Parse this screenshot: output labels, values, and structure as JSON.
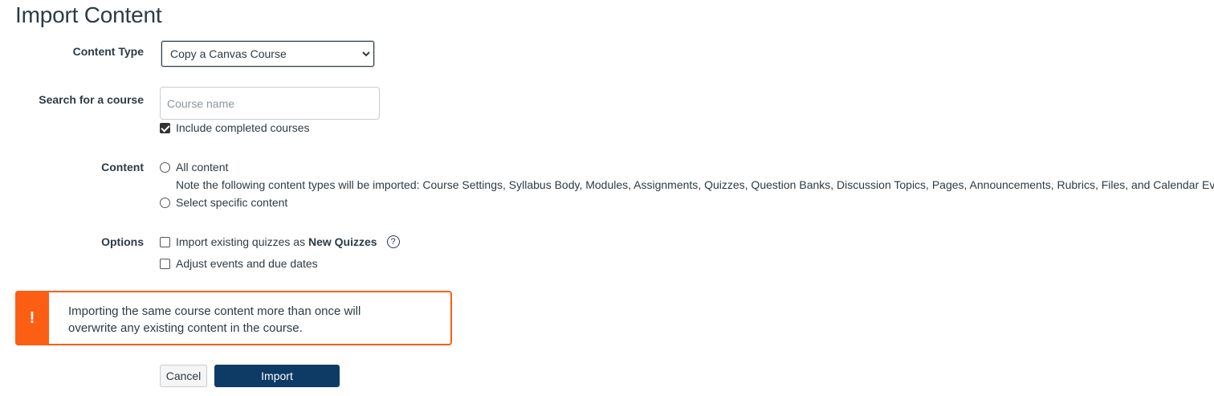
{
  "page": {
    "title": "Import Content"
  },
  "content_type": {
    "label": "Content Type",
    "selected": "Copy a Canvas Course"
  },
  "search": {
    "label": "Search for a course",
    "placeholder": "Course name",
    "include_completed_label": "Include completed courses",
    "include_completed_checked": true
  },
  "content": {
    "label": "Content",
    "all_content_label": "All content",
    "note": "Note the following content types will be imported: Course Settings, Syllabus Body, Modules, Assignments, Quizzes, Question Banks, Discussion Topics, Pages, Announcements, Rubrics, Files, and Calendar Events.",
    "select_specific_label": "Select specific content"
  },
  "options": {
    "label": "Options",
    "import_quizzes_prefix": "Import existing quizzes as ",
    "import_quizzes_bold": "New Quizzes",
    "help_icon": "question-circle-icon",
    "adjust_dates_label": "Adjust events and due dates"
  },
  "alert": {
    "icon": "!",
    "text": "Importing the same course content more than once will overwrite any existing content in the course.",
    "color": "#fc5e13"
  },
  "buttons": {
    "cancel": "Cancel",
    "import": "Import",
    "import_color": "#0e3a66"
  }
}
